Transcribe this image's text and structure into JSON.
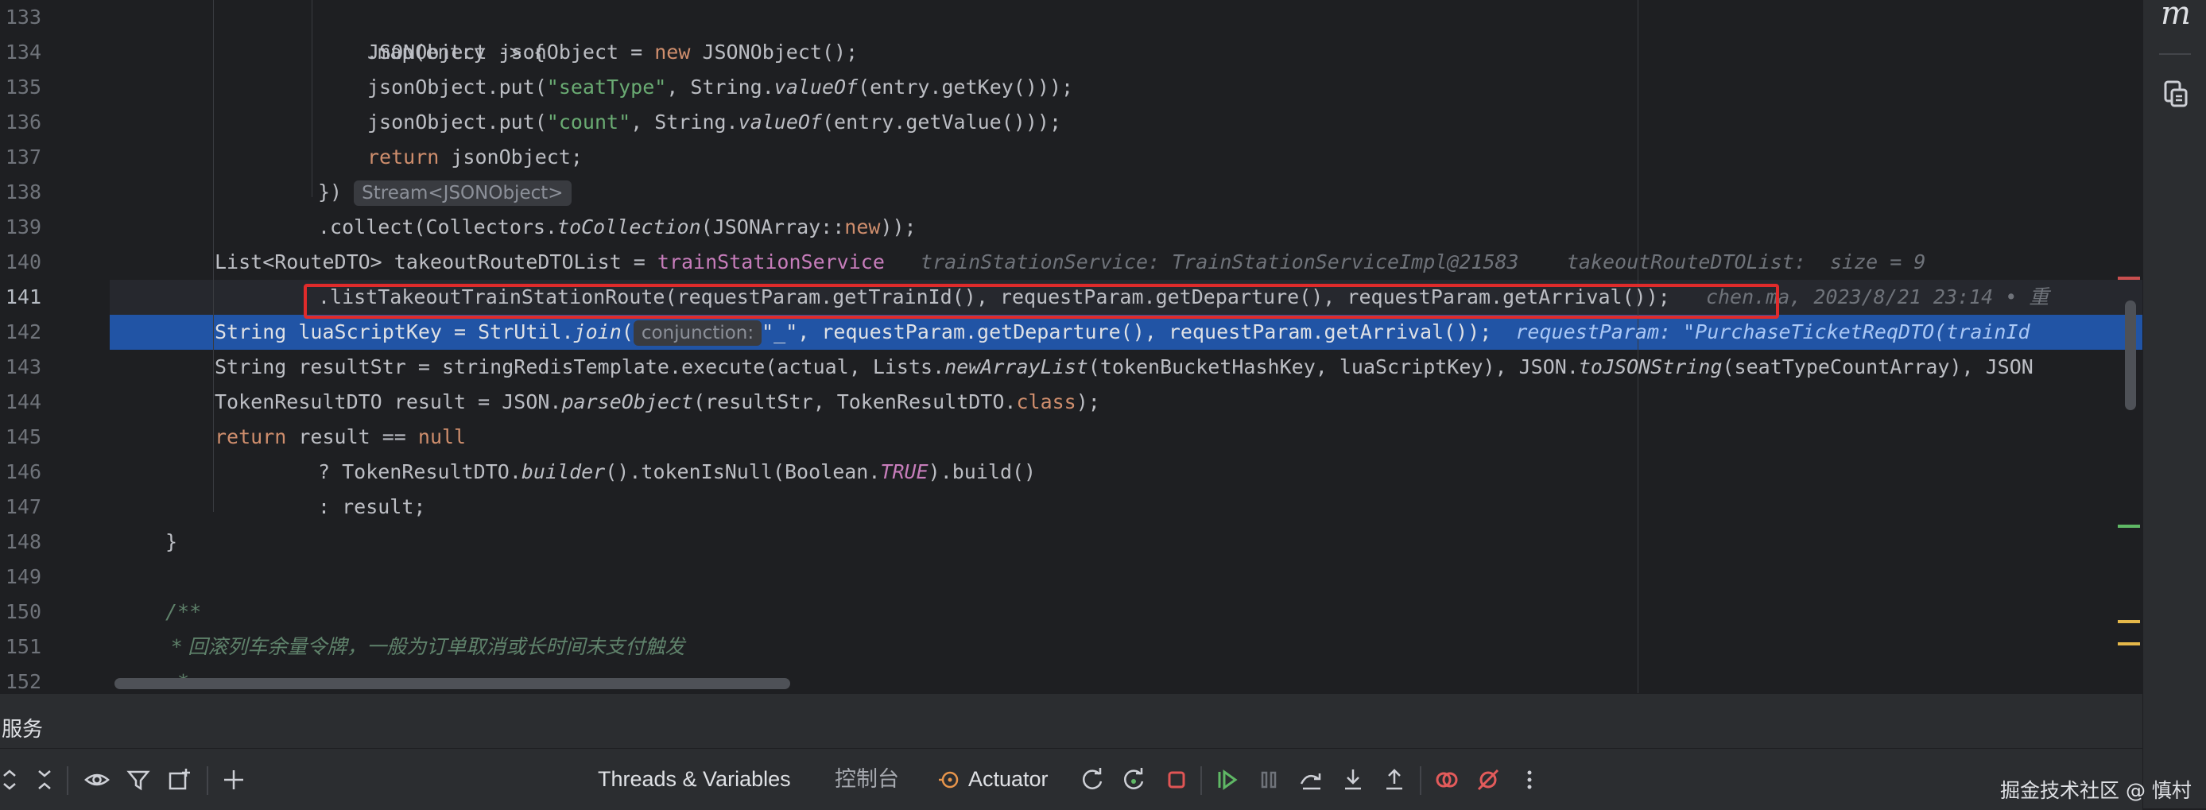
{
  "editor": {
    "line_numbers": [
      "133",
      "134",
      "135",
      "136",
      "137",
      "138",
      "139",
      "140",
      "141",
      "142",
      "143",
      "144",
      "145",
      "146",
      "147",
      "148",
      "149",
      "150",
      "151",
      "152"
    ],
    "current_line": "141",
    "execution_line": "142",
    "lines": {
      "l133": {
        "map": ".map(entry -> {"
      },
      "l134": {
        "a": "JSONObject jsonObject = ",
        "kw_new": "new",
        "b": " JSONObject();"
      },
      "l135": {
        "a": "jsonObject.put(",
        "str": "\"seatType\"",
        "b": ", String.",
        "fn": "valueOf",
        "c": "(entry.getKey()));"
      },
      "l136": {
        "a": "jsonObject.put(",
        "str": "\"count\"",
        "b": ", String.",
        "fn": "valueOf",
        "c": "(entry.getValue()));"
      },
      "l137": {
        "kw_return": "return",
        "a": " jsonObject;"
      },
      "l138": {
        "a": "})",
        "hint": "Stream<JSONObject>"
      },
      "l139": {
        "a": ".collect(Collectors.",
        "fn": "toCollection",
        "b": "(JSONArray::",
        "kw_new": "new",
        "c": "));"
      },
      "l140": {
        "a": "List<RouteDTO> takeoutRouteDTOList = ",
        "field": "trainStationService",
        "inline1": "trainStationService: TrainStationServiceImpl@21583",
        "inline2": "takeoutRouteDTOList:  size = 9"
      },
      "l141": {
        "a": ".listTakeoutTrainStationRoute(requestParam.getTrainId(), requestParam.getDeparture(), requestParam.getArrival());",
        "blame": "chen.ma, 2023/8/21 23:14 • 重"
      },
      "l142": {
        "a": "String luaScriptKey = StrUtil.",
        "fn": "join",
        "b": "(",
        "hint": "conjunction:",
        "str": "\"_\"",
        "c": ", requestParam.getDeparture(), requestParam.getArrival());",
        "inline": "requestParam: \"PurchaseTicketReqDTO(trainId"
      },
      "l143": {
        "a": "String resultStr = stringRedisTemplate.execute(actual, Lists.",
        "fn": "newArrayList",
        "b": "(tokenBucketHashKey, luaScriptKey), JSON.",
        "fn2": "toJSONString",
        "c": "(seatTypeCountArray), JSON"
      },
      "l144": {
        "a": "TokenResultDTO result = JSON.",
        "fn": "parseObject",
        "b": "(resultStr, TokenResultDTO.",
        "kw_class": "class",
        "c": ");"
      },
      "l145": {
        "kw_return": "return",
        "a": " result == ",
        "kw_null": "null"
      },
      "l146": {
        "a": "? TokenResultDTO.",
        "fn": "builder",
        "b": "().tokenIsNull(Boolean.",
        "const": "TRUE",
        "c": ").build()"
      },
      "l147": {
        "a": ": result;"
      },
      "l148": {
        "a": "}"
      },
      "l149": {
        "a": ""
      },
      "l150": {
        "a": "/**"
      },
      "l151": {
        "a": " * 回滚列车余量令牌，一般为订单取消或长时间未支付触发"
      },
      "l152": {
        "a": " *"
      }
    }
  },
  "right_bar": {
    "logo": "m",
    "icons": [
      "structure-icon"
    ]
  },
  "services_panel": {
    "title": "服务",
    "tabs": {
      "threads": "Threads & Variables",
      "console": "控制台",
      "actuator": "Actuator"
    },
    "watermark": "掘金技术社区 @ 慎村",
    "colors": {
      "accent_green": "#5fb865",
      "stop_red": "#e05555",
      "bp_red": "#e35b5b",
      "actuator_orange": "#e8954b"
    }
  }
}
